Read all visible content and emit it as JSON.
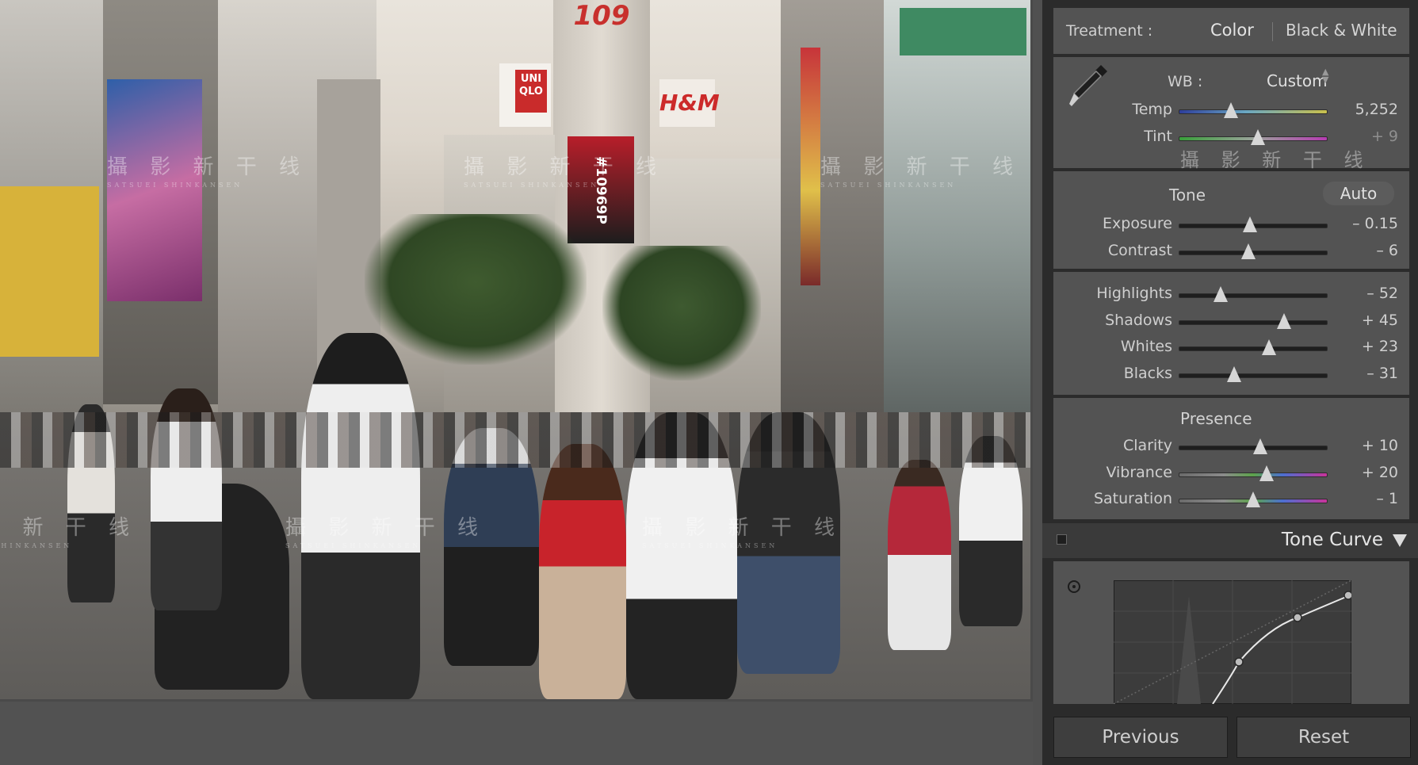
{
  "treatment": {
    "label": "Treatment :",
    "color": "Color",
    "bw": "Black & White"
  },
  "wb": {
    "label": "WB :",
    "value": "Custom"
  },
  "temp": {
    "label": "Temp",
    "value": "5,252",
    "pos": 0.35
  },
  "tint": {
    "label": "Tint",
    "value": "+ 9",
    "pos": 0.53
  },
  "tone": {
    "header": "Tone",
    "auto": "Auto"
  },
  "exposure": {
    "label": "Exposure",
    "value": "– 0.15",
    "pos": 0.48
  },
  "contrast": {
    "label": "Contrast",
    "value": "– 6",
    "pos": 0.47
  },
  "highlights": {
    "label": "Highlights",
    "value": "– 52",
    "pos": 0.28
  },
  "shadows": {
    "label": "Shadows",
    "value": "+ 45",
    "pos": 0.71
  },
  "whites": {
    "label": "Whites",
    "value": "+ 23",
    "pos": 0.61
  },
  "blacks": {
    "label": "Blacks",
    "value": "– 31",
    "pos": 0.37
  },
  "presence": {
    "header": "Presence"
  },
  "clarity": {
    "label": "Clarity",
    "value": "+ 10",
    "pos": 0.55
  },
  "vibrance": {
    "label": "Vibrance",
    "value": "+ 20",
    "pos": 0.59
  },
  "saturation": {
    "label": "Saturation",
    "value": "– 1",
    "pos": 0.5
  },
  "tonecurve": {
    "title": "Tone Curve"
  },
  "buttons": {
    "previous": "Previous",
    "reset": "Reset"
  },
  "photo_signs": {
    "top": "109",
    "uniqlo": "UNI QLO",
    "hm": "H&M",
    "billboard": "#10969P"
  },
  "watermark": {
    "text": "攝 影 新 干 线",
    "sub": "SATSUEI SHINKANSEN"
  },
  "colors": {
    "panel_bg": "#2b2b2b",
    "section_bg": "#535353",
    "text": "#cfcfcf",
    "thumb": "#d6d6d6"
  }
}
